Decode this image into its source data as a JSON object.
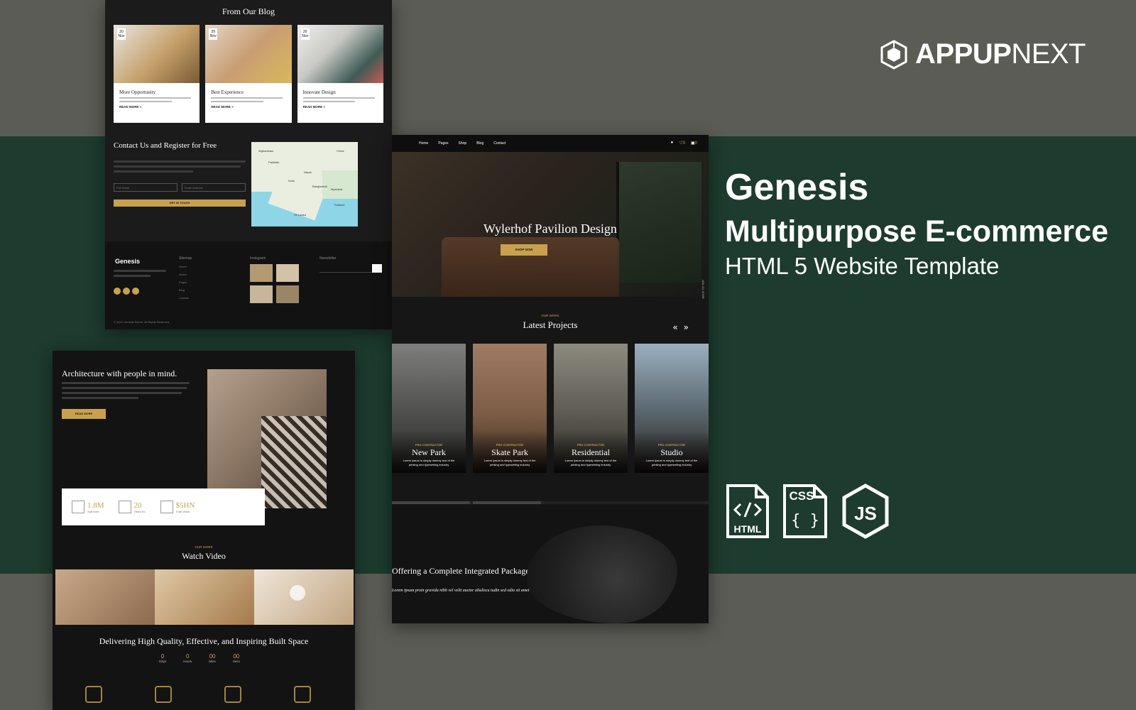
{
  "brand": {
    "logo_text_bold": "APPUP",
    "logo_text_light": "NEXT"
  },
  "promo": {
    "title": "Genesis",
    "subtitle": "Multipurpose E-commerce",
    "tagline": "HTML 5 Website Template"
  },
  "tech_badges": [
    {
      "label": "HTML",
      "icon": "html-file-icon"
    },
    {
      "label": "CSS",
      "icon": "css-file-icon"
    },
    {
      "label": "JS",
      "icon": "nodejs-hex-icon"
    }
  ],
  "blog": {
    "title": "From Our Blog",
    "cards": [
      {
        "date_day": "20",
        "date_mon": "Nov",
        "title": "More Opportunity",
        "read_more": "READ MORE >"
      },
      {
        "date_day": "20",
        "date_mon": "Nov",
        "title": "Best Experience",
        "read_more": "READ MORE >"
      },
      {
        "date_day": "20",
        "date_mon": "Nov",
        "title": "Innovate Design",
        "read_more": "READ MORE >"
      }
    ]
  },
  "contact": {
    "title": "Contact Us and Register for Free",
    "name_placeholder": "Full Name",
    "email_placeholder": "Email Address",
    "button": "GET IN TOUCH",
    "map_labels": [
      "Afghanistan",
      "China",
      "Pakistan",
      "India",
      "Nepal",
      "Bangladesh",
      "Myanmar",
      "Thailand",
      "Sri Lanka"
    ]
  },
  "footer": {
    "logo": "Genesis",
    "columns": [
      "Sitemap",
      "Instagram",
      "Newsletter"
    ],
    "sitemap_items": [
      "Home",
      "About",
      "Pages",
      "Blog",
      "Contact"
    ],
    "copyright": "© 2021 Genesis theme. All Rights Reserved."
  },
  "nav": {
    "links": [
      "Home",
      "Pages",
      "Shop",
      "Blog",
      "Contact"
    ],
    "cart_count": "0",
    "wishlist_count": "0"
  },
  "hero": {
    "title": "Wylerhof Pavilion Design",
    "button": "SHOP NOW",
    "back_to_top": "BACK TO TOP"
  },
  "projects": {
    "subtitle": "OUR WORK",
    "title": "Latest Projects",
    "prev": "«",
    "next": "»",
    "items": [
      {
        "category": "PRO CONTRACTOR",
        "name": "New Park",
        "desc": "Lorem Ipsum is simply dummy text of the printing and typesetting industry"
      },
      {
        "category": "PRO CONTRACTOR",
        "name": "Skate Park",
        "desc": "Lorem Ipsum is simply dummy text of the printing and typesetting industry"
      },
      {
        "category": "PRO CONTRACTOR",
        "name": "Residential",
        "desc": "Lorem Ipsum is simply dummy text of the printing and typesetting industry"
      },
      {
        "category": "PRO CONTRACTOR",
        "name": "Studio",
        "desc": "Lorem Ipsum is simply dummy text of the printing and typesetting industry"
      }
    ]
  },
  "offer": {
    "title": "Offering a Complete Integrated Package",
    "desc": "Lorem ipsum proin gravida nibh vel velit auctor aliuliscu tudin sed odio sit amet nibh vulputate"
  },
  "architecture": {
    "title": "Architecture with people in mind.",
    "button": "READ MORE",
    "stats": [
      {
        "value": "1.8M",
        "label": "Sqft Area"
      },
      {
        "value": "20",
        "label": "Years Ex."
      },
      {
        "value": "$5HN",
        "label": "Total Value"
      }
    ]
  },
  "video": {
    "subtitle": "OUR WORK",
    "title": "Watch Video"
  },
  "deliver": {
    "title": "Delivering High Quality, Effective, and Inspiring Built Space",
    "counters": [
      {
        "value": "0",
        "unit": "Days"
      },
      {
        "value": "0",
        "unit": "Hours"
      },
      {
        "value": "00",
        "unit": "Mins"
      },
      {
        "value": "00",
        "unit": "Secs"
      }
    ]
  },
  "colors": {
    "accent_gold": "#c9a14e",
    "bg_gray": "#5b5c55",
    "bg_green": "#1d3b2e",
    "panel_dark": "#1b1b1b"
  }
}
